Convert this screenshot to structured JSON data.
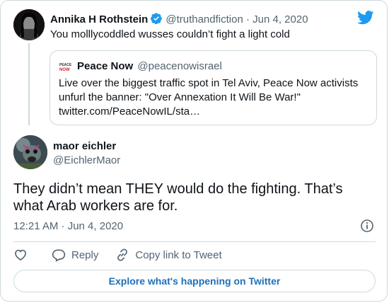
{
  "parent_tweet": {
    "name": "Annika H Rothstein",
    "handle": "@truthandfiction",
    "separator": "·",
    "date": "Jun 4, 2020",
    "text": "You molllycoddled wusses couldn’t fight a light cold"
  },
  "quoted_tweet": {
    "logo_text": "PEACE NOW",
    "name": "Peace Now",
    "handle": "@peacenowisrael",
    "text": "Live over the biggest traffic spot in Tel Aviv, Peace Now activists unfurl the banner: \"Over Annexation It Will Be War!\" twitter.com/PeaceNowIL/sta…"
  },
  "main_tweet": {
    "name": "maor eichler",
    "handle": "@EichlerMaor",
    "text": "They didn’t mean THEY would do the fighting. That’s what Arab workers are for.",
    "timestamp": "12:21 AM · Jun 4, 2020"
  },
  "actions": {
    "reply_label": "Reply",
    "copy_link_label": "Copy link to Tweet"
  },
  "explore_label": "Explore what's happening on Twitter",
  "icons": {
    "brand": "twitter-bird-icon",
    "verified": "verified-badge-icon",
    "info": "info-icon",
    "like": "heart-icon",
    "reply": "reply-bubble-icon",
    "copy_link": "link-icon"
  },
  "colors": {
    "twitter_blue": "#1d9bf0",
    "link_blue": "#1d70b8",
    "secondary_text": "#536471",
    "border": "#cfd9de"
  }
}
